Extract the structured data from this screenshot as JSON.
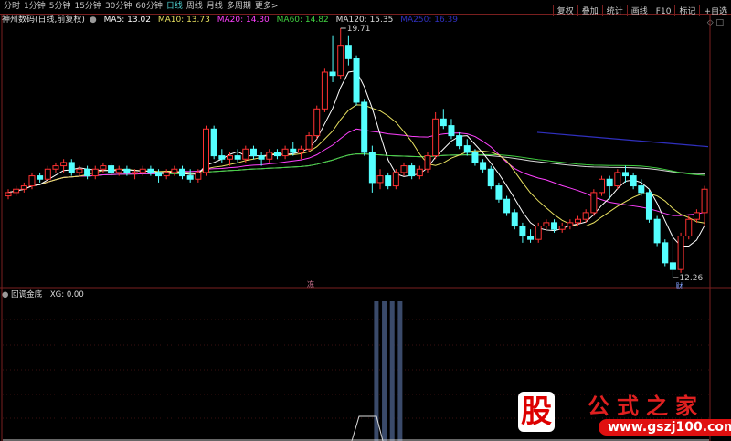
{
  "toolbar": {
    "periods": [
      "分时",
      "1分钟",
      "5分钟",
      "15分钟",
      "30分钟",
      "60分钟",
      "日线",
      "周线",
      "月线",
      "多周期",
      "更多>"
    ],
    "active": "日线",
    "right_buttons": [
      "复权",
      "叠加",
      "统计",
      "画线",
      "F10",
      "标记",
      "+自选"
    ]
  },
  "header": {
    "title": "神州数码(日线,前复权)",
    "ma5": "MA5: 13.02",
    "ma10": "MA10: 13.73",
    "ma20": "MA20: 14.30",
    "ma60": "MA60: 14.82",
    "ma120": "MA120: 15.35",
    "ma250": "MA250: 16.39"
  },
  "corner_icons": "◇ □",
  "chart": {
    "high_label": "19.71",
    "low_label": "12.26",
    "marker_mid": "冻",
    "marker_low": "财",
    "up_color": "#ff3232",
    "down_color": "#54ffff",
    "ma_colors": {
      "ma5": "#ffffff",
      "ma10": "#e8e060",
      "ma20": "#ff40ff",
      "ma60": "#40d040",
      "ma120": "#d8d8d8",
      "ma250": "#3030c0"
    }
  },
  "chart_data": {
    "type": "candlestick",
    "ohlc": [
      [
        14.7,
        14.9,
        14.6,
        14.8
      ],
      [
        14.8,
        15.0,
        14.7,
        14.9
      ],
      [
        14.9,
        15.1,
        14.8,
        15.0
      ],
      [
        15.0,
        15.4,
        14.9,
        15.3
      ],
      [
        15.3,
        15.4,
        15.1,
        15.2
      ],
      [
        15.2,
        15.6,
        15.1,
        15.5
      ],
      [
        15.5,
        15.7,
        15.4,
        15.6
      ],
      [
        15.6,
        15.8,
        15.4,
        15.7
      ],
      [
        15.7,
        15.8,
        15.3,
        15.4
      ],
      [
        15.4,
        15.6,
        15.3,
        15.5
      ],
      [
        15.5,
        15.6,
        15.2,
        15.3
      ],
      [
        15.3,
        15.6,
        15.2,
        15.5
      ],
      [
        15.5,
        15.7,
        15.4,
        15.6
      ],
      [
        15.6,
        15.7,
        15.3,
        15.4
      ],
      [
        15.4,
        15.6,
        15.3,
        15.5
      ],
      [
        15.5,
        15.6,
        15.3,
        15.4
      ],
      [
        15.4,
        15.5,
        15.2,
        15.4
      ],
      [
        15.4,
        15.6,
        15.3,
        15.5
      ],
      [
        15.5,
        15.6,
        15.3,
        15.4
      ],
      [
        15.4,
        15.5,
        15.1,
        15.3
      ],
      [
        15.3,
        15.5,
        15.2,
        15.4
      ],
      [
        15.4,
        15.6,
        15.3,
        15.5
      ],
      [
        15.5,
        15.6,
        15.2,
        15.3
      ],
      [
        15.3,
        15.5,
        15.1,
        15.2
      ],
      [
        15.2,
        15.5,
        15.1,
        15.4
      ],
      [
        15.4,
        16.8,
        15.3,
        16.7
      ],
      [
        16.7,
        16.8,
        15.8,
        15.9
      ],
      [
        15.9,
        16.1,
        15.7,
        15.8
      ],
      [
        15.8,
        16.0,
        15.6,
        15.9
      ],
      [
        15.9,
        16.1,
        15.7,
        15.8
      ],
      [
        15.8,
        16.2,
        15.7,
        16.1
      ],
      [
        16.1,
        16.2,
        15.8,
        15.9
      ],
      [
        15.9,
        16.0,
        15.6,
        15.8
      ],
      [
        15.8,
        16.1,
        15.7,
        16.0
      ],
      [
        16.0,
        16.1,
        15.8,
        15.9
      ],
      [
        15.9,
        16.2,
        15.8,
        16.1
      ],
      [
        16.1,
        16.3,
        15.9,
        16.0
      ],
      [
        16.0,
        16.2,
        15.8,
        16.1
      ],
      [
        16.1,
        16.6,
        16.0,
        16.5
      ],
      [
        16.5,
        17.4,
        16.4,
        17.3
      ],
      [
        17.3,
        18.5,
        17.2,
        18.4
      ],
      [
        18.4,
        19.5,
        18.1,
        18.3
      ],
      [
        18.3,
        19.71,
        18.2,
        19.2
      ],
      [
        19.2,
        19.5,
        18.6,
        18.8
      ],
      [
        18.8,
        18.9,
        17.4,
        17.5
      ],
      [
        17.5,
        17.6,
        15.9,
        16.0
      ],
      [
        16.0,
        16.2,
        14.8,
        15.1
      ],
      [
        15.1,
        15.5,
        14.9,
        15.3
      ],
      [
        15.3,
        15.4,
        14.9,
        15.0
      ],
      [
        15.0,
        15.5,
        14.9,
        15.4
      ],
      [
        15.4,
        15.7,
        15.3,
        15.6
      ],
      [
        15.6,
        15.7,
        15.2,
        15.3
      ],
      [
        15.3,
        15.6,
        15.2,
        15.5
      ],
      [
        15.5,
        16.0,
        15.4,
        15.9
      ],
      [
        15.9,
        17.2,
        15.8,
        17.0
      ],
      [
        17.0,
        17.3,
        16.7,
        16.8
      ],
      [
        16.8,
        17.0,
        16.4,
        16.5
      ],
      [
        16.5,
        16.6,
        16.1,
        16.2
      ],
      [
        16.2,
        16.4,
        15.9,
        16.0
      ],
      [
        16.0,
        16.1,
        15.6,
        15.7
      ],
      [
        15.7,
        15.8,
        15.4,
        15.5
      ],
      [
        15.5,
        15.6,
        14.9,
        15.0
      ],
      [
        15.0,
        15.1,
        14.5,
        14.6
      ],
      [
        14.6,
        14.7,
        14.1,
        14.2
      ],
      [
        14.2,
        14.3,
        13.7,
        13.8
      ],
      [
        13.8,
        13.9,
        13.3,
        13.5
      ],
      [
        13.5,
        13.7,
        13.3,
        13.4
      ],
      [
        13.4,
        13.9,
        13.3,
        13.8
      ],
      [
        13.8,
        14.0,
        13.7,
        13.9
      ],
      [
        13.9,
        14.0,
        13.6,
        13.7
      ],
      [
        13.7,
        13.9,
        13.6,
        13.8
      ],
      [
        13.8,
        14.0,
        13.7,
        13.9
      ],
      [
        13.9,
        14.1,
        13.8,
        14.0
      ],
      [
        14.0,
        14.3,
        13.9,
        14.2
      ],
      [
        14.2,
        14.9,
        14.1,
        14.8
      ],
      [
        14.8,
        15.3,
        14.7,
        15.2
      ],
      [
        15.2,
        15.3,
        14.6,
        15.0
      ],
      [
        15.0,
        15.5,
        14.9,
        15.4
      ],
      [
        15.4,
        15.6,
        15.1,
        15.3
      ],
      [
        15.3,
        15.4,
        14.9,
        15.0
      ],
      [
        15.0,
        15.2,
        14.7,
        14.8
      ],
      [
        14.8,
        14.9,
        13.9,
        14.0
      ],
      [
        14.0,
        14.1,
        13.2,
        13.3
      ],
      [
        13.3,
        13.4,
        12.6,
        12.7
      ],
      [
        12.7,
        13.6,
        12.26,
        12.5
      ],
      [
        12.5,
        13.6,
        12.4,
        13.5
      ],
      [
        13.5,
        14.1,
        13.4,
        14.0
      ],
      [
        14.0,
        14.3,
        13.9,
        14.2
      ],
      [
        14.2,
        15.0,
        13.8,
        14.9
      ]
    ],
    "ylim": [
      11.9,
      20.2
    ]
  },
  "indicator": {
    "name": "回调金底",
    "value": "XG: 0.00",
    "signal_index": [
      40,
      41,
      42,
      43
    ]
  },
  "watermark": {
    "char": "股",
    "title": "公式之家",
    "url": "www.gszj100.com"
  }
}
